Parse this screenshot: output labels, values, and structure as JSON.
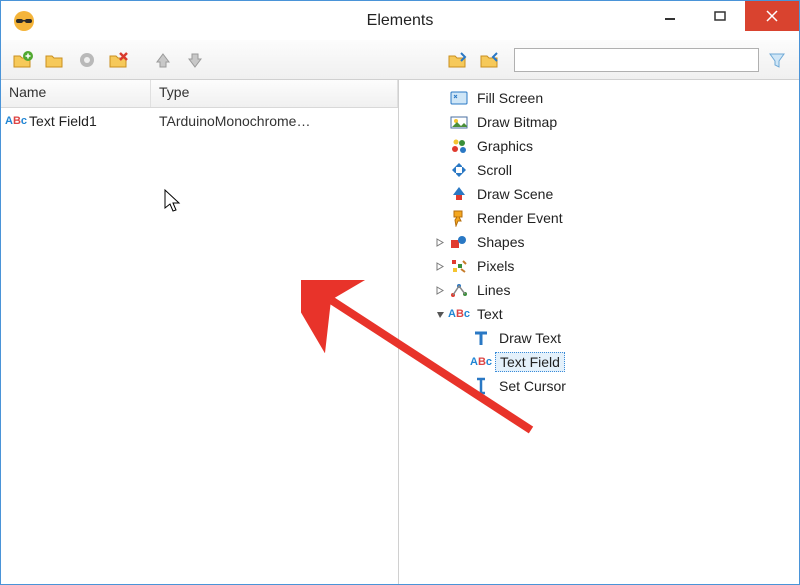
{
  "window": {
    "title": "Elements"
  },
  "toolbar": {
    "search_placeholder": ""
  },
  "list": {
    "columns": {
      "name": "Name",
      "type": "Type"
    },
    "rows": [
      {
        "name": "Text Field1",
        "type": "TArduinoMonochrome…"
      }
    ]
  },
  "tree": {
    "items": [
      {
        "label": "Fill Screen",
        "icon": "fill-screen-icon",
        "indent": 1,
        "expander": "none"
      },
      {
        "label": "Draw Bitmap",
        "icon": "bitmap-icon",
        "indent": 1,
        "expander": "none"
      },
      {
        "label": "Graphics",
        "icon": "graphics-icon",
        "indent": 1,
        "expander": "none"
      },
      {
        "label": "Scroll",
        "icon": "scroll-icon",
        "indent": 1,
        "expander": "none"
      },
      {
        "label": "Draw Scene",
        "icon": "scene-icon",
        "indent": 1,
        "expander": "none"
      },
      {
        "label": "Render Event",
        "icon": "render-icon",
        "indent": 1,
        "expander": "none"
      },
      {
        "label": "Shapes",
        "icon": "shapes-icon",
        "indent": 1,
        "expander": "closed"
      },
      {
        "label": "Pixels",
        "icon": "pixels-icon",
        "indent": 1,
        "expander": "closed"
      },
      {
        "label": "Lines",
        "icon": "lines-icon",
        "indent": 1,
        "expander": "closed"
      },
      {
        "label": "Text",
        "icon": "abc-icon",
        "indent": 1,
        "expander": "open"
      },
      {
        "label": "Draw Text",
        "icon": "draw-text-icon",
        "indent": 2,
        "expander": "none"
      },
      {
        "label": "Text Field",
        "icon": "abc-icon",
        "indent": 2,
        "expander": "none",
        "selected": true
      },
      {
        "label": "Set Cursor",
        "icon": "cursor-icon",
        "indent": 2,
        "expander": "none"
      }
    ]
  }
}
